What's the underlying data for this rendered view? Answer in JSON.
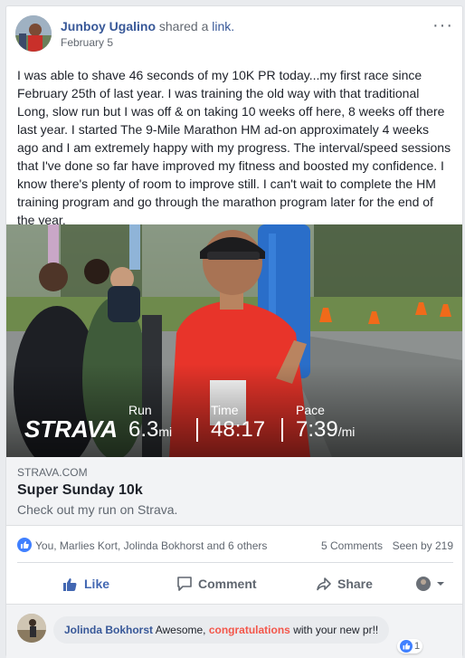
{
  "post": {
    "author": "Junboy Ugalino",
    "action_text": "shared a",
    "link_word": "link.",
    "date": "February 5",
    "more_label": "···",
    "text": "I was able to shave 46 seconds of my 10K PR today...my first race since February 25th of last year. I was training the old way with that traditional Long, slow run but I was off & on taking 10 weeks off here, 8 weeks off there last year. I started The 9-Mile Marathon HM ad-on approximately 4 weeks ago and I am extremely happy with my progress. The interval/speed sessions that I've done so far have improved my fitness and boosted my confidence. I know there's plenty of room to improve still. I can't wait to complete the HM training program and go through the marathon program later for the end of the year."
  },
  "strava_overlay": {
    "logo": "STRAVA",
    "run_label": "Run",
    "run_value": "6.3",
    "run_unit": "mi",
    "time_label": "Time",
    "time_value": "48:17",
    "pace_label": "Pace",
    "pace_value": "7:39",
    "pace_unit": "/mi"
  },
  "link_preview": {
    "domain": "STRAVA.COM",
    "title": "Super Sunday 10k",
    "description": "Check out my run on Strava."
  },
  "reactions": {
    "names": "You, Marlies Kort, Jolinda Bokhorst and 6 others",
    "comments": "5 Comments",
    "seen": "Seen by 219"
  },
  "actions": {
    "like": "Like",
    "comment": "Comment",
    "share": "Share"
  },
  "comment": {
    "author": "Jolinda Bokhorst",
    "text_before": "Awesome,",
    "highlight": "congratulations",
    "text_after": "with your new pr!!",
    "like_count": "1"
  },
  "colors": {
    "link_blue": "#385898",
    "like_blue": "#4267b2",
    "shirt_red": "#e8342a",
    "highlight_red": "#f3574b"
  }
}
